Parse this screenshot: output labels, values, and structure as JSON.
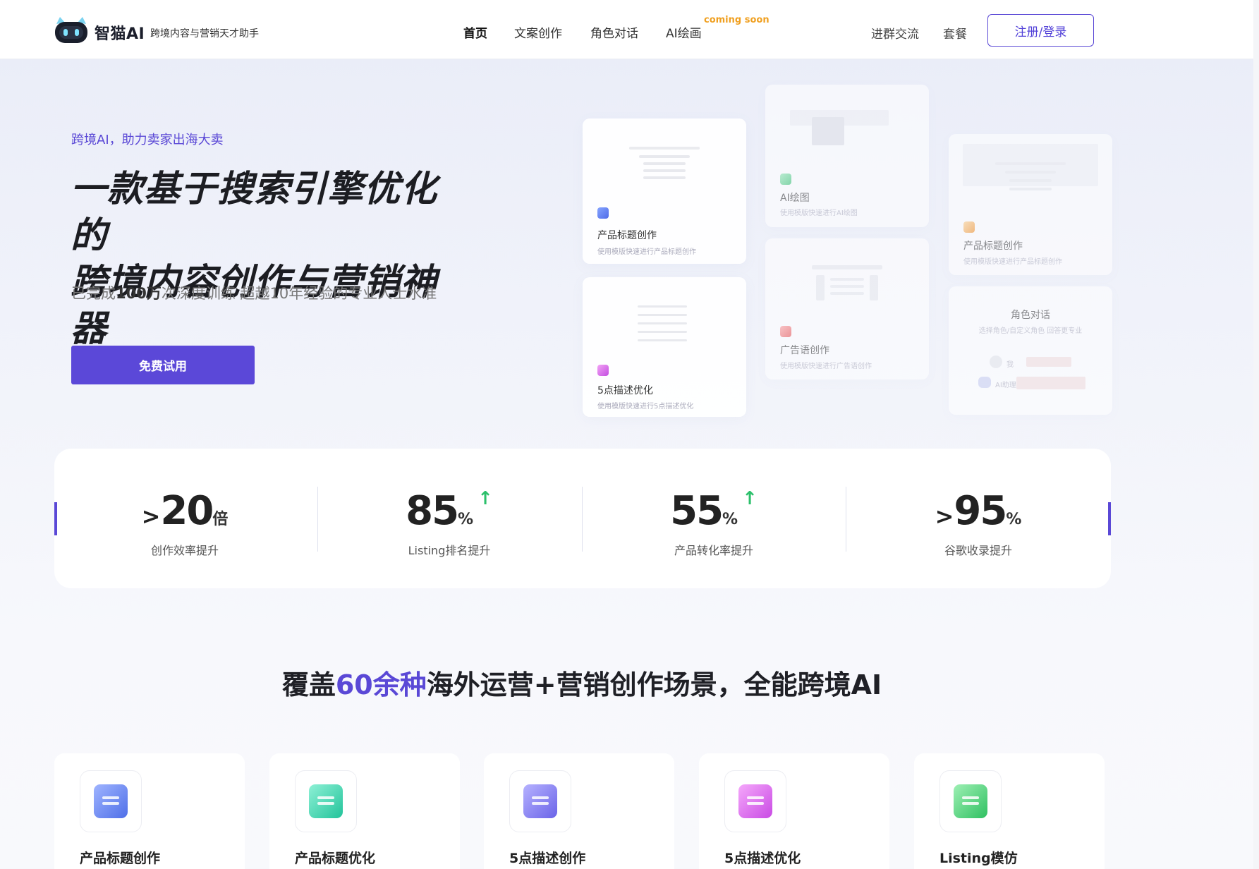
{
  "header": {
    "logo_text": "智猫AI",
    "tagline": "跨境内容与营销天才助手",
    "nav": [
      {
        "label": "首页",
        "active": true
      },
      {
        "label": "文案创作",
        "active": false
      },
      {
        "label": "角色对话",
        "active": false
      },
      {
        "label": "AI绘画",
        "active": false
      }
    ],
    "coming_soon": "coming soon",
    "group_link": "进群交流",
    "plan_link": "套餐",
    "login_button": "注册/登录"
  },
  "hero": {
    "eyebrow": "跨境AI，助力卖家出海大卖",
    "title_line1": "一款基于搜索引擎优化的",
    "title_line2": "跨境内容创作与营销神器",
    "sub_prefix": "已完成",
    "sub_bold": "100万",
    "sub_suffix": "次深度训练 超越10年经验的专业人士水准",
    "cta": "免费试用"
  },
  "preview_cards": {
    "card1": {
      "title": "产品标题创作",
      "desc": "使用模版快速进行产品标题创作",
      "icon": "cube-icon",
      "color": "#5b7cf0"
    },
    "card2": {
      "title": "5点描述优化",
      "desc": "使用模版快速进行5点描述优化",
      "icon": "bag-icon",
      "color": "#d86ae8"
    },
    "card3": {
      "title": "AI绘图",
      "desc": "使用模版快速进行AI绘图",
      "icon": "image-icon",
      "color": "#3ccf7c"
    },
    "card4": {
      "title": "广告语创作",
      "desc": "使用模版快速进行广告语创作",
      "icon": "megaphone-icon",
      "color": "#f06b6b"
    },
    "card5": {
      "title": "产品标题创作",
      "desc": "使用模版快速进行产品标题创作",
      "icon": "doc-icon",
      "color": "#f5a13b"
    },
    "card6": {
      "title": "角色对话",
      "desc": "选择角色/自定义角色 回答更专业",
      "me_label": "我",
      "bot_label": "AI助理"
    }
  },
  "stats": [
    {
      "prefix": ">",
      "number": "20",
      "unit": "倍",
      "arrow": "",
      "label": "创作效率提升"
    },
    {
      "prefix": "",
      "number": "85",
      "unit": "%",
      "arrow": "↑",
      "label": "Listing排名提升"
    },
    {
      "prefix": "",
      "number": "55",
      "unit": "%",
      "arrow": "↑",
      "label": "产品转化率提升"
    },
    {
      "prefix": ">",
      "number": "95",
      "unit": "%",
      "arrow": "",
      "label": "谷歌收录提升"
    }
  ],
  "section": {
    "title_prefix": "覆盖",
    "title_highlight": "60余种",
    "title_suffix": "海外运营+营销创作场景，全能跨境AI"
  },
  "features": [
    {
      "title": "产品标题创作",
      "icon": "edit-icon",
      "color": "#4f7cf3"
    },
    {
      "title": "产品标题优化",
      "icon": "rocket-icon",
      "color": "#33d1a8"
    },
    {
      "title": "5点描述创作",
      "icon": "list-icon",
      "color": "#7a74f0"
    },
    {
      "title": "5点描述优化",
      "icon": "bag-icon",
      "color": "#d65ee6"
    },
    {
      "title": "Listing模仿",
      "icon": "clipboard-icon",
      "color": "#3ccf6a"
    }
  ]
}
